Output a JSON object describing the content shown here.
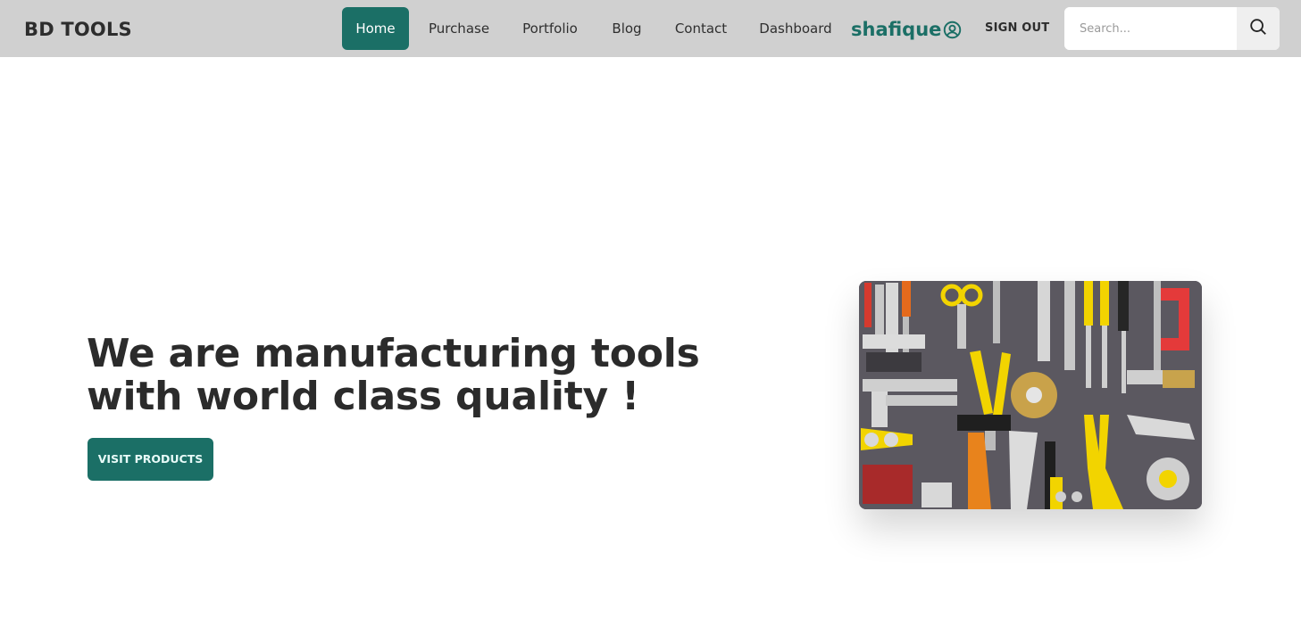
{
  "brand": {
    "name": "BD TOOLS"
  },
  "nav": {
    "items": [
      {
        "label": "Home",
        "active": true
      },
      {
        "label": "Purchase"
      },
      {
        "label": "Portfolio"
      },
      {
        "label": "Blog"
      },
      {
        "label": "Contact"
      },
      {
        "label": "Dashboard"
      }
    ],
    "user": {
      "name": "shafique",
      "icon": "user-circle-icon"
    },
    "signout_label": "SIGN OUT",
    "search": {
      "placeholder": "Search...",
      "value": "",
      "icon": "search-icon"
    }
  },
  "hero": {
    "title": "We are manufacturing tools with world class quality !",
    "cta_label": "VISIT PRODUCTS",
    "image": "tools-flatlay-photo"
  },
  "colors": {
    "accent": "#1b6f66",
    "navbar_bg": "#d0d0d0",
    "text": "#2d2d2d"
  }
}
